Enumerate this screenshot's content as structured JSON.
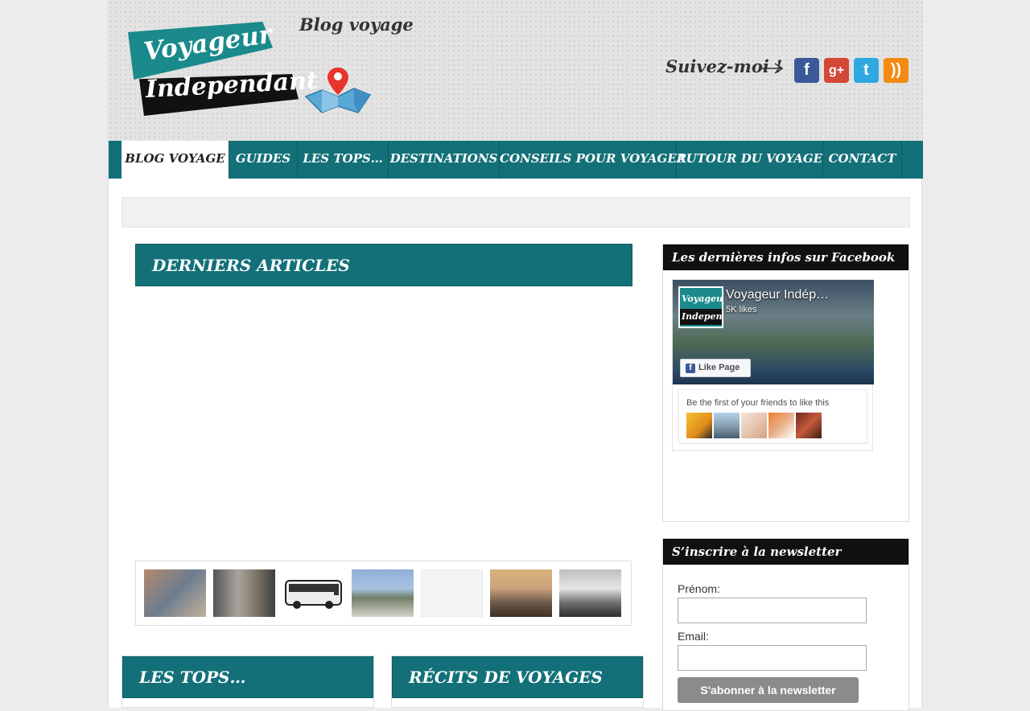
{
  "header": {
    "logo_line1": "Voyageur",
    "logo_line2": "Independant",
    "tagline": "Blog voyage",
    "follow_label": "Suivez-moi !",
    "social": [
      {
        "name": "facebook",
        "glyph": "f",
        "color": "#3b5998"
      },
      {
        "name": "google-plus",
        "glyph": "g+",
        "color": "#d34836"
      },
      {
        "name": "twitter",
        "glyph": "t",
        "color": "#2fa8e0"
      },
      {
        "name": "rss",
        "glyph": "))",
        "color": "#f28b10"
      }
    ]
  },
  "nav": {
    "items": [
      {
        "label": "Blog voyage"
      },
      {
        "label": "Guides"
      },
      {
        "label": "Les tops…"
      },
      {
        "label": "Destinations"
      },
      {
        "label": "Conseils pour voyager"
      },
      {
        "label": "Autour du voyage"
      },
      {
        "label": "Contact"
      }
    ],
    "active_index": 0
  },
  "main": {
    "latest_title": "Derniers articles",
    "tops_title": "Les tops…",
    "stories_title": "Récits de voyages"
  },
  "sidebar": {
    "facebook": {
      "title": "Les dernières infos sur Facebook",
      "page_name": "Voyageur Indép…",
      "likes": "5K likes",
      "avatar_line1": "Voyageur",
      "avatar_line2": "Independa",
      "like_button": "Like Page",
      "friends_text": "Be the first of your friends to like this"
    },
    "newsletter": {
      "title": "S’inscrire à la newsletter",
      "firstname_label": "Prénom:",
      "email_label": "Email:",
      "submit_label": "S'abonner à la newsletter",
      "firstname_value": "",
      "email_value": ""
    }
  },
  "colors": {
    "teal": "#137078",
    "brand_teal": "#1a8a8c",
    "dark": "#111111"
  }
}
